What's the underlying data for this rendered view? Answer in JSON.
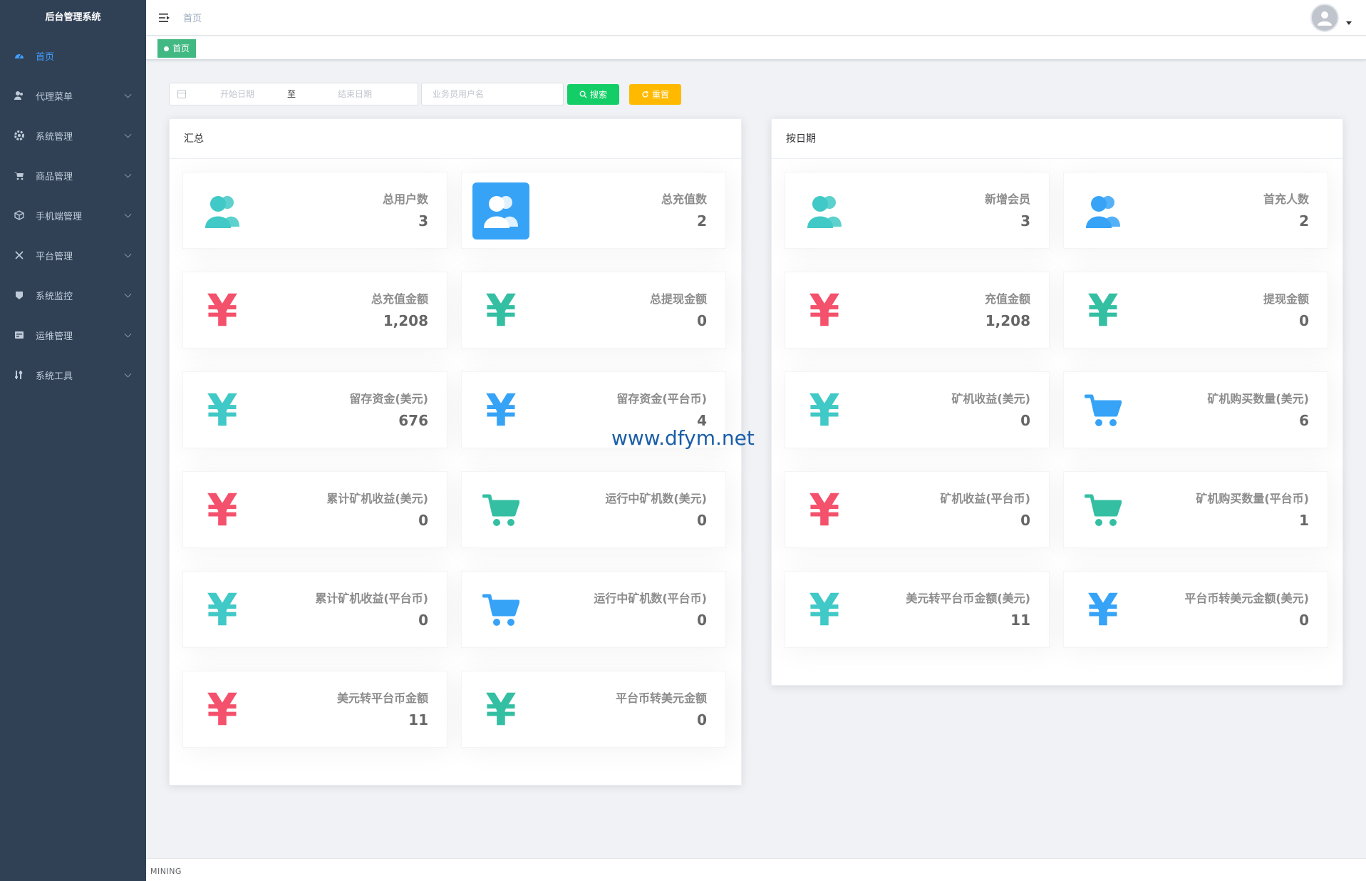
{
  "sidebar": {
    "title": "后台管理系统",
    "items": [
      {
        "label": "首页",
        "icon": "dashboard-icon",
        "active": true
      },
      {
        "label": "代理菜单",
        "icon": "user-icon"
      },
      {
        "label": "系统管理",
        "icon": "gear-icon"
      },
      {
        "label": "商品管理",
        "icon": "shopping-cart-icon"
      },
      {
        "label": "手机端管理",
        "icon": "cube-icon"
      },
      {
        "label": "平台管理",
        "icon": "tools-icon"
      },
      {
        "label": "系统监控",
        "icon": "monitor-icon"
      },
      {
        "label": "运维管理",
        "icon": "server-icon"
      },
      {
        "label": "系统工具",
        "icon": "wrench-icon"
      }
    ]
  },
  "navbar": {
    "breadcrumb": "首页"
  },
  "tags": {
    "active": "首页"
  },
  "search": {
    "start_placeholder": "开始日期",
    "separator": "至",
    "end_placeholder": "结束日期",
    "user_placeholder": "业务员用户名",
    "search_label": "搜索",
    "reset_label": "重置"
  },
  "summary": {
    "title": "汇总",
    "cards": [
      {
        "label": "总用户数",
        "value": "3",
        "icon": "people-icon",
        "color": "#40c9c6",
        "filled": false
      },
      {
        "label": "总充值数",
        "value": "2",
        "icon": "people-icon",
        "color": "#ffffff",
        "filled": true
      },
      {
        "label": "总充值金额",
        "value": "1,208",
        "icon": "yen-icon",
        "color": "#f4516c"
      },
      {
        "label": "总提现金额",
        "value": "0",
        "icon": "yen-icon",
        "color": "#34bfa3"
      },
      {
        "label": "留存资金(美元)",
        "value": "676",
        "icon": "yen-icon",
        "color": "#40c9c6"
      },
      {
        "label": "留存资金(平台币)",
        "value": "4",
        "icon": "yen-icon",
        "color": "#36a3f7"
      },
      {
        "label": "累计矿机收益(美元)",
        "value": "0",
        "icon": "yen-icon",
        "color": "#f4516c"
      },
      {
        "label": "运行中矿机数(美元)",
        "value": "0",
        "icon": "cart-icon",
        "color": "#34bfa3"
      },
      {
        "label": "累计矿机收益(平台币)",
        "value": "0",
        "icon": "yen-icon",
        "color": "#40c9c6"
      },
      {
        "label": "运行中矿机数(平台币)",
        "value": "0",
        "icon": "cart-icon",
        "color": "#36a3f7"
      },
      {
        "label": "美元转平台币金额",
        "value": "11",
        "icon": "yen-icon",
        "color": "#f4516c"
      },
      {
        "label": "平台币转美元金额",
        "value": "0",
        "icon": "yen-icon",
        "color": "#34bfa3"
      }
    ]
  },
  "bydate": {
    "title": "按日期",
    "cards": [
      {
        "label": "新增会员",
        "value": "3",
        "icon": "people-icon",
        "color": "#40c9c6"
      },
      {
        "label": "首充人数",
        "value": "2",
        "icon": "people-icon",
        "color": "#36a3f7"
      },
      {
        "label": "充值金额",
        "value": "1,208",
        "icon": "yen-icon",
        "color": "#f4516c"
      },
      {
        "label": "提现金额",
        "value": "0",
        "icon": "yen-icon",
        "color": "#34bfa3"
      },
      {
        "label": "矿机收益(美元)",
        "value": "0",
        "icon": "yen-icon",
        "color": "#40c9c6"
      },
      {
        "label": "矿机购买数量(美元)",
        "value": "6",
        "icon": "cart-icon",
        "color": "#36a3f7"
      },
      {
        "label": "矿机收益(平台币)",
        "value": "0",
        "icon": "yen-icon",
        "color": "#f4516c"
      },
      {
        "label": "矿机购买数量(平台币)",
        "value": "1",
        "icon": "cart-icon",
        "color": "#34bfa3"
      },
      {
        "label": "美元转平台币金额(美元)",
        "value": "11",
        "icon": "yen-icon",
        "color": "#40c9c6"
      },
      {
        "label": "平台币转美元金额(美元)",
        "value": "0",
        "icon": "yen-icon",
        "color": "#36a3f7"
      }
    ]
  },
  "watermark": "www.dfym.net",
  "footer": {
    "text": "MINING"
  }
}
